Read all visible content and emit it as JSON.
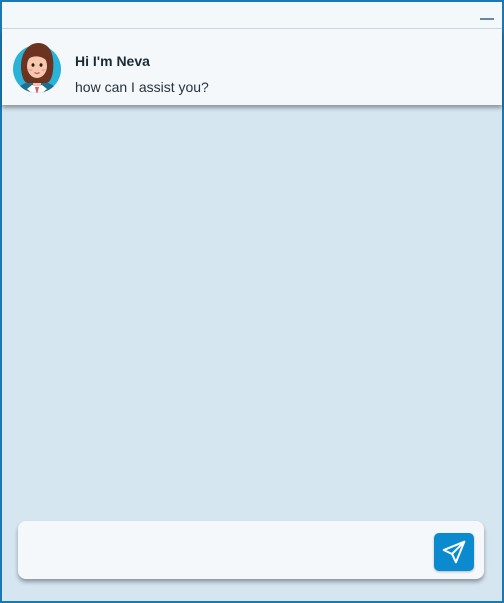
{
  "titlebar": {
    "minimize_icon": "minimize-icon"
  },
  "header": {
    "title": "Hi I'm Neva",
    "subtitle": "how can I assist you?",
    "avatar_icon": "assistant-avatar"
  },
  "chat": {
    "messages": []
  },
  "composer": {
    "value": "",
    "placeholder": "",
    "send_icon": "send-icon"
  },
  "colors": {
    "window_border": "#1a78b4",
    "background": "#d6e6f1",
    "card": "#f4f8fb",
    "accent": "#0c8ad0"
  }
}
